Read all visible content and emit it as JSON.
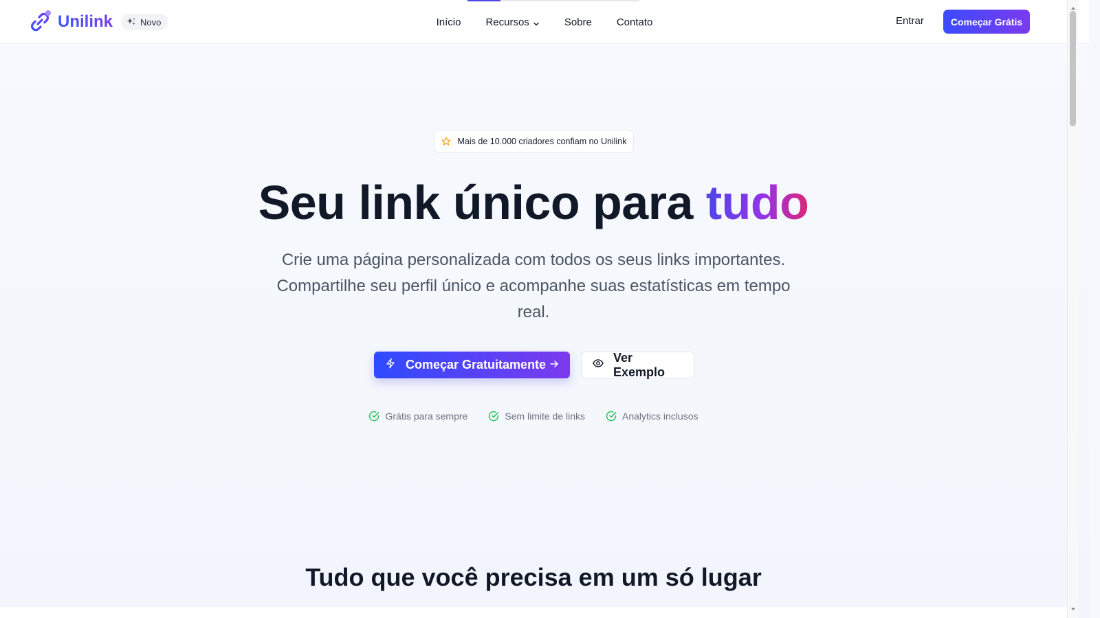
{
  "header": {
    "brand": "Unilink",
    "badge": "Novo",
    "nav": [
      {
        "label": "Início"
      },
      {
        "label": "Recursos"
      },
      {
        "label": "Sobre"
      },
      {
        "label": "Contato"
      }
    ],
    "login": "Entrar",
    "cta": "Começar Grátis"
  },
  "hero": {
    "trust_badge": "Mais de 10.000 criadores confiam no Unilink",
    "title_main": "Seu link único para ",
    "title_accent": "tudo",
    "subtitle": "Crie uma página personalizada com todos os seus links importantes. Compartilhe seu perfil único e acompanhe suas estatísticas em tempo real.",
    "primary_button": "Começar Gratuitamente",
    "secondary_button": "Ver Exemplo",
    "features": [
      {
        "label": "Grátis para sempre"
      },
      {
        "label": "Sem limite de links"
      },
      {
        "label": "Analytics inclusos"
      }
    ]
  },
  "section": {
    "title": "Tudo que você precisa em um só lugar"
  },
  "icons": {
    "logo": "link-icon",
    "badge": "sparkles-icon",
    "trust": "star-icon",
    "primary": "zap-icon",
    "primary_trailing": "arrow-right-icon",
    "secondary": "eye-icon",
    "feature": "check-circle-icon"
  },
  "colors": {
    "brand_gradient_start": "#3b4bff",
    "brand_gradient_end": "#7c3aed",
    "accent_end": "#db2777",
    "check_green": "#22c55e",
    "star_amber": "#f59e0b"
  },
  "nav_progress": 0.19
}
